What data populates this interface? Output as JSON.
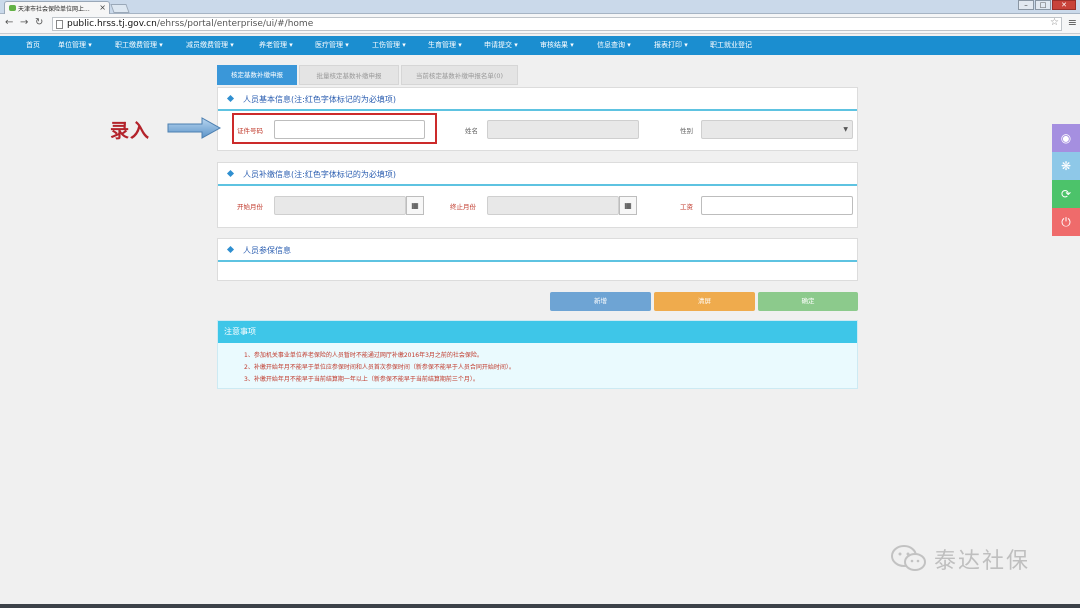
{
  "browser": {
    "tab_title": "天津市社会保险单位网上...",
    "tab_close": "×",
    "url_host": "public.hrss.tj.gov.cn",
    "url_path": "/ehrss/portal/enterprise/ui/#/home"
  },
  "nav": {
    "items": [
      "首页",
      "单位管理 ▾",
      "职工缴费管理 ▾",
      "减员缴费管理 ▾",
      "养老管理 ▾",
      "医疗管理 ▾",
      "工伤管理 ▾",
      "生育管理 ▾",
      "申请提交 ▾",
      "审核结果 ▾",
      "信息查询 ▾",
      "报表打印 ▾",
      "职工就业登记"
    ]
  },
  "subtabs": {
    "active": "核定基数补缴申报",
    "batch": "批量核定基数补缴申报",
    "list": "当前核定基数补缴申报名单(0)"
  },
  "sections": {
    "basic_title": "人员基本信息(注:红色字体标记的为必填项)",
    "supplement_title": "人员补缴信息(注:红色字体标记的为必填项)",
    "insured_title": "人员参保信息"
  },
  "fields": {
    "id_label": "证件号码",
    "id_value": "",
    "name_label": "姓名",
    "gender_label": "性别",
    "start_label": "开始月份",
    "end_label": "终止月份",
    "wage_label": "工资"
  },
  "buttons": {
    "add": "新增",
    "clear": "清屏",
    "confirm": "确定"
  },
  "notice": {
    "title": "注意事项",
    "lines": [
      "1、参加机关事业单位养老保险的人员暂时不能通过网厅补缴2016年3月之前的社会保险。",
      "2、补缴开始年月不能早于单位应参保时间和人员首次参保时间（新参保不能早于人员合同开始时间）。",
      "3、补缴开始年月不能早于当前结算期一年以上（新参保不能早于当前结算期前三个月）。"
    ]
  },
  "annotation": {
    "label": "录入"
  },
  "watermark": {
    "text": "泰达社保"
  },
  "colors": {
    "nav_blue": "#1b8ed0",
    "accent_cyan": "#3ec6e8",
    "required_red": "#c0392b",
    "btn_blue": "#6ea4d4",
    "btn_orange": "#efab4d",
    "btn_green": "#8cca8c"
  },
  "side_icons": [
    "eye-icon",
    "tree-icon",
    "refresh-icon",
    "power-icon"
  ]
}
